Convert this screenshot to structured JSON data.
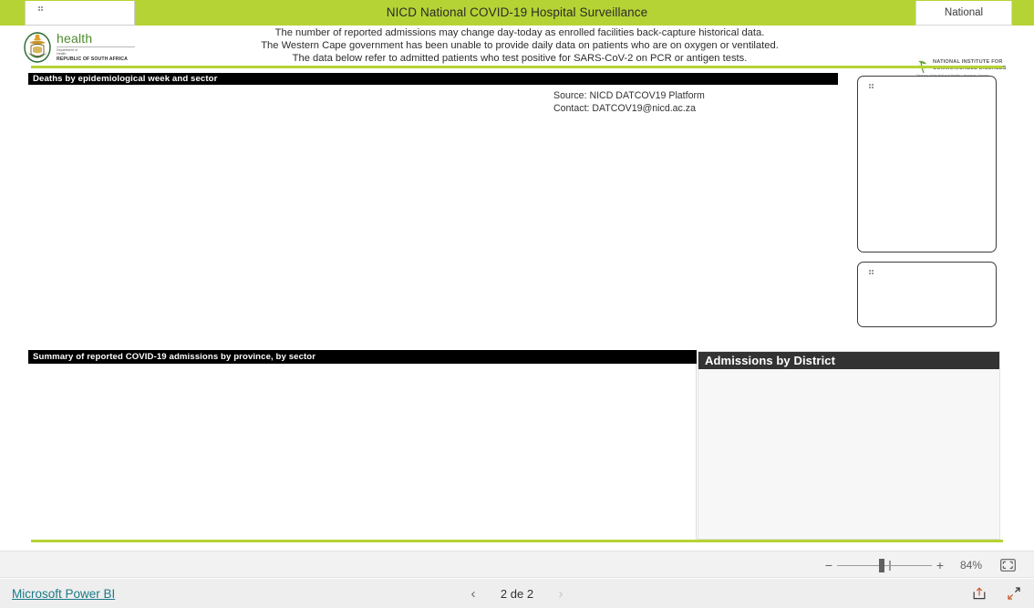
{
  "report": {
    "title": "NICD National COVID-19 Hospital Surveillance",
    "slicer_national_label": "National",
    "notes": [
      "The number of reported admissions may change day-today as enrolled facilities back-capture historical data.",
      "The Western Cape government has been unable to provide daily data on patients who are on oxygen or ventilated.",
      "The data below refer to admitted patients who test positive for SARS-CoV-2 on PCR or antigen tests."
    ],
    "sa_logo": {
      "wordmark": "health",
      "department_line1": "Department of",
      "department_line2": "Health",
      "republic": "REPUBLIC OF SOUTH AFRICA"
    },
    "nicd_logo": {
      "line1": "NATIONAL INSTITUTE FOR",
      "line2": "COMMUNICABLE DISEASES",
      "line3": "Division of the National Health Laboratory Service"
    },
    "visuals": {
      "deaths_title": "Deaths by epidemiological week and sector",
      "province_summary_title": "Summary of reported COVID-19 admissions by province, by sector",
      "district_title": "Admissions by District"
    },
    "source": {
      "source_line": "Source: NICD DATCOV19 Platform",
      "contact_line": "Contact: DATCOV19@nicd.ac.za"
    },
    "colors": {
      "brand_green": "#b5d334",
      "panel_black": "#000000",
      "district_header": "#333333",
      "link_teal": "#1a7b88"
    }
  },
  "viewer": {
    "zoom": {
      "minus_label": "−",
      "plus_label": "+",
      "percent_label": "84%",
      "fit_icon": "fit-to-page-icon"
    },
    "footer": {
      "brand_link": "Microsoft Power BI",
      "prev_label": "‹",
      "next_label": "›",
      "page_label": "2 de 2",
      "share_icon": "share-icon",
      "fullscreen_icon": "fullscreen-icon"
    }
  }
}
